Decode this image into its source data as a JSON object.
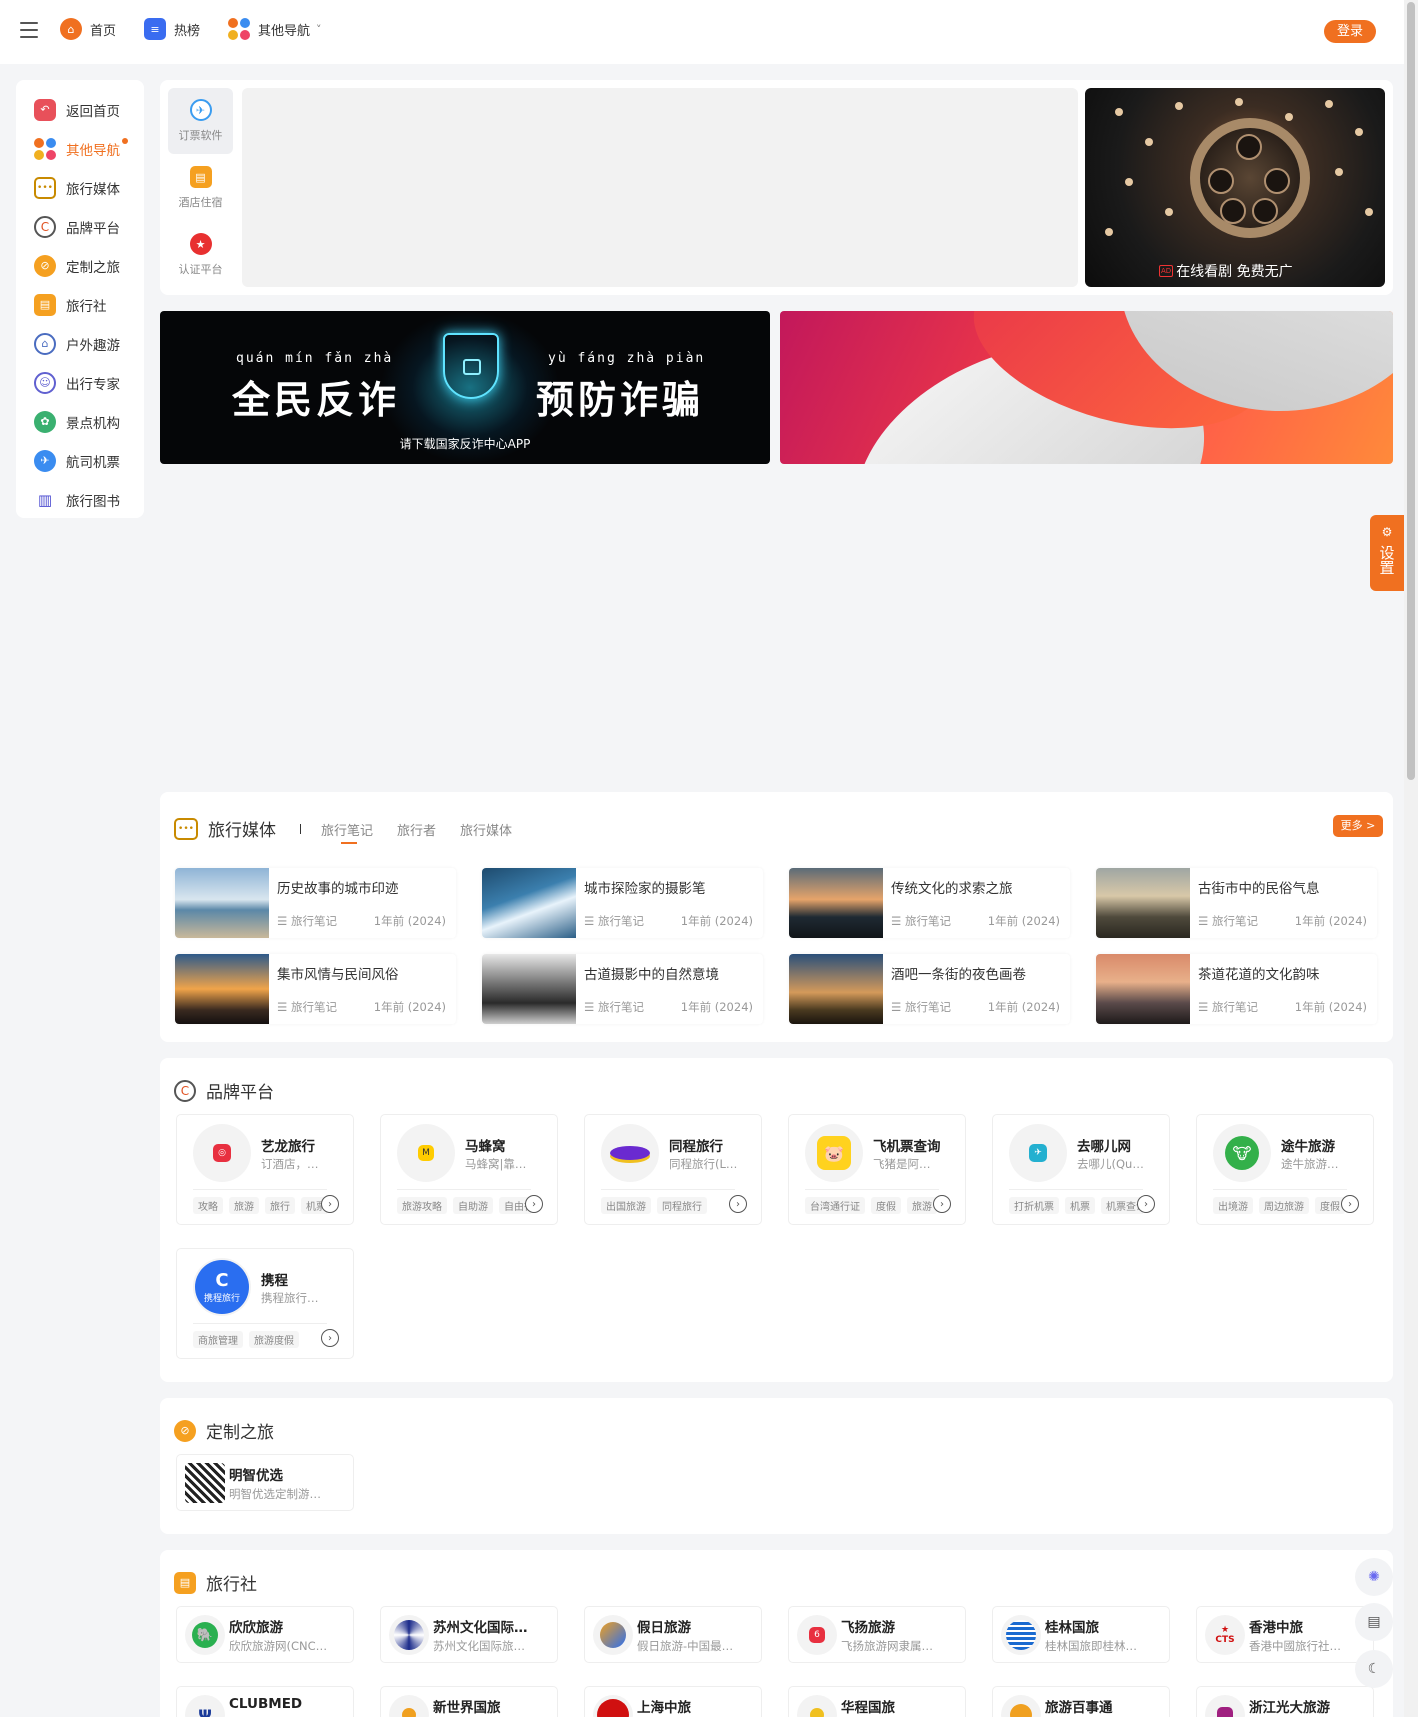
{
  "topnav": {
    "items": [
      {
        "label": "首页",
        "icon": "home-icon",
        "color": "#f07020"
      },
      {
        "label": "热榜",
        "icon": "hot-list-icon",
        "color": "#3a6cf0"
      },
      {
        "label": "其他导航",
        "icon": "clover-icon",
        "color": "#f0a020"
      }
    ],
    "dropdown_glyph": "˅",
    "login_label": "登录"
  },
  "sidebar": {
    "items": [
      {
        "label": "返回首页",
        "icon": "back-home-icon"
      },
      {
        "label": "其他导航",
        "icon": "clover-icon",
        "active": true
      },
      {
        "label": "旅行媒体",
        "icon": "chat-bubble-icon"
      },
      {
        "label": "品牌平台",
        "icon": "brand-icon"
      },
      {
        "label": "定制之旅",
        "icon": "compass-icon"
      },
      {
        "label": "旅行社",
        "icon": "agency-icon"
      },
      {
        "label": "户外趣游",
        "icon": "outdoor-icon"
      },
      {
        "label": "出行专家",
        "icon": "expert-icon"
      },
      {
        "label": "景点机构",
        "icon": "scenic-icon"
      },
      {
        "label": "航司机票",
        "icon": "airline-icon"
      },
      {
        "label": "旅行图书",
        "icon": "books-icon"
      }
    ]
  },
  "hero": {
    "tabs": [
      {
        "label": "订票软件",
        "icon": "ticket-icon",
        "active": true
      },
      {
        "label": "酒店住宿",
        "icon": "hotel-icon"
      },
      {
        "label": "认证平台",
        "icon": "trophy-icon"
      }
    ],
    "ad_badge": "AD",
    "ad_text": "在线看剧 免费无广"
  },
  "banner_fraud": {
    "pinyin_left": "quán mín fǎn zhà",
    "title_left": "全民反诈",
    "pinyin_right": "yù fáng zhà piàn",
    "title_right": "预防诈骗",
    "footer": "请下载国家反诈中心APP"
  },
  "media": {
    "title": "旅行媒体",
    "tabs": [
      "旅行笔记",
      "旅行者",
      "旅行媒体"
    ],
    "more_label": "更多 >",
    "posts": [
      {
        "title": "历史故事的城市印迹",
        "category": "旅行笔记",
        "time": "1年前 (2024)"
      },
      {
        "title": "城市探险家的摄影笔",
        "category": "旅行笔记",
        "time": "1年前 (2024)"
      },
      {
        "title": "传统文化的求索之旅",
        "category": "旅行笔记",
        "time": "1年前 (2024)"
      },
      {
        "title": "古街市中的民俗气息",
        "category": "旅行笔记",
        "time": "1年前 (2024)"
      },
      {
        "title": "集市风情与民间风俗",
        "category": "旅行笔记",
        "time": "1年前 (2024)"
      },
      {
        "title": "古道摄影中的自然意境",
        "category": "旅行笔记",
        "time": "1年前 (2024)"
      },
      {
        "title": "酒吧一条街的夜色画卷",
        "category": "旅行笔记",
        "time": "1年前 (2024)"
      },
      {
        "title": "茶道花道的文化韵味",
        "category": "旅行笔记",
        "time": "1年前 (2024)"
      }
    ]
  },
  "brand": {
    "title": "品牌平台",
    "cards": [
      {
        "name": "艺龙旅行",
        "desc": "订酒店，…",
        "tags": [
          "攻略",
          "旅游",
          "旅行",
          "机票"
        ]
      },
      {
        "name": "马蜂窝",
        "desc": "马蜂窝|靠…",
        "tags": [
          "旅游攻略",
          "自助游",
          "自由行"
        ]
      },
      {
        "name": "同程旅行",
        "desc": "同程旅行(L…",
        "tags": [
          "出国旅游",
          "同程旅行"
        ]
      },
      {
        "name": "飞机票查询",
        "desc": "飞猪是阿…",
        "tags": [
          "台湾通行证",
          "度假",
          "旅游"
        ]
      },
      {
        "name": "去哪儿网",
        "desc": "去哪儿(Qu…",
        "tags": [
          "打折机票",
          "机票",
          "机票查询"
        ]
      },
      {
        "name": "途牛旅游",
        "desc": "途牛旅游…",
        "tags": [
          "出境游",
          "周边旅游",
          "度假"
        ]
      },
      {
        "name": "携程",
        "desc": "携程旅行…",
        "tags": [
          "商旅管理",
          "旅游度假"
        ]
      }
    ],
    "go_glyph": "›",
    "ctrip_logo_text": "携程旅行"
  },
  "custom": {
    "title": "定制之旅",
    "items": [
      {
        "name": "明智优选",
        "desc": "明智优选定制游…"
      }
    ]
  },
  "agency": {
    "title": "旅行社",
    "items": [
      {
        "name": "欣欣旅游",
        "desc": "欣欣旅游网(CNC…"
      },
      {
        "name": "苏州文化国际…",
        "desc": "苏州文化国际旅…"
      },
      {
        "name": "假日旅游",
        "desc": "假日旅游-中国最…"
      },
      {
        "name": "飞扬旅游",
        "desc": "飞扬旅游网隶属…"
      },
      {
        "name": "桂林国旅",
        "desc": "桂林国旅即桂林…"
      },
      {
        "name": "香港中旅",
        "desc": "香港中國旅行社…"
      },
      {
        "name": "CLUBMED",
        "desc": ""
      },
      {
        "name": "新世界国旅",
        "desc": ""
      },
      {
        "name": "上海中旅",
        "desc": ""
      },
      {
        "name": "华程国旅",
        "desc": ""
      },
      {
        "name": "旅游百事通",
        "desc": ""
      },
      {
        "name": "浙江光大旅游",
        "desc": ""
      }
    ],
    "cts_logo_text": "CTS"
  },
  "settings_label": "设置",
  "colors": {
    "accent": "#f07020",
    "brand_blue": "#3a6cf0"
  }
}
